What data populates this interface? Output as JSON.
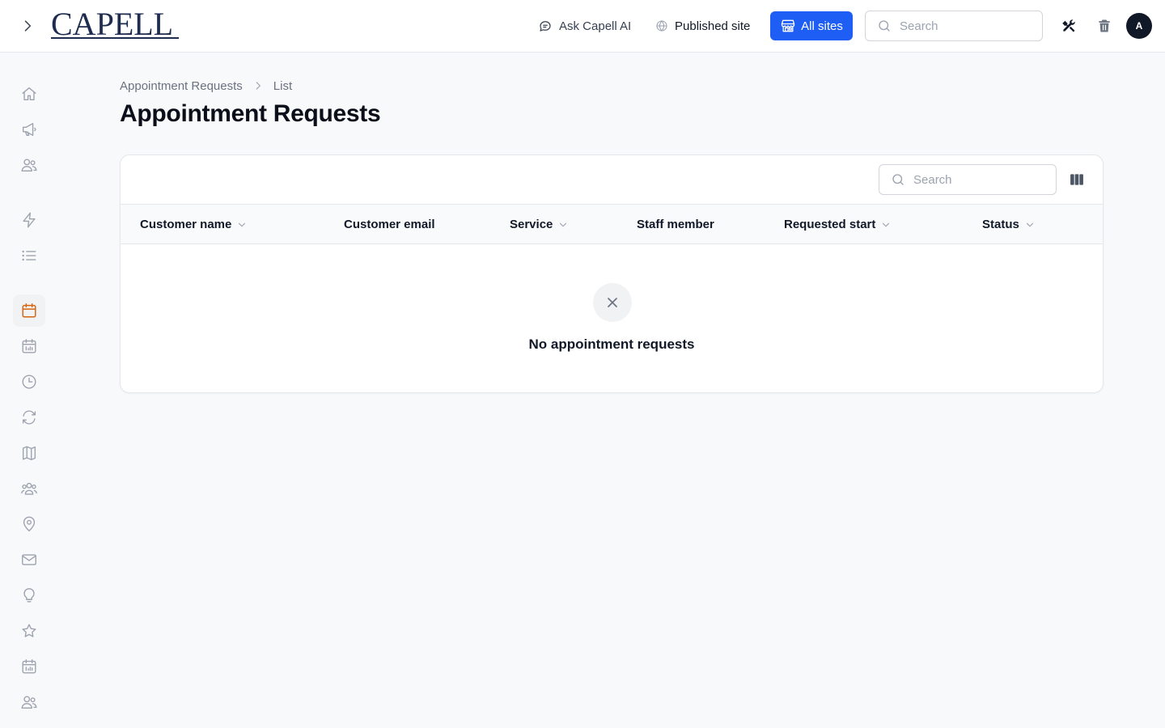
{
  "brand": {
    "logo_text": "CAPELL"
  },
  "header": {
    "ask_ai_label": "Ask Capell AI",
    "published_site_label": "Published site",
    "all_sites_label": "All sites",
    "search_placeholder": "Search",
    "avatar_initial": "A"
  },
  "colors": {
    "accent": "#1f5ef5",
    "active_icon": "#d9640f",
    "brand_navy": "#1d2c4f"
  },
  "sidebar": {
    "items": [
      {
        "icon": "home-icon"
      },
      {
        "icon": "megaphone-icon"
      },
      {
        "icon": "users-icon"
      },
      {
        "icon": "lightning-icon"
      },
      {
        "icon": "list-icon"
      },
      {
        "icon": "calendar-icon",
        "active": true
      },
      {
        "icon": "calendar-days-icon"
      },
      {
        "icon": "clock-icon"
      },
      {
        "icon": "refresh-icon"
      },
      {
        "icon": "map-icon"
      },
      {
        "icon": "user-group-icon"
      },
      {
        "icon": "map-pin-icon"
      },
      {
        "icon": "envelope-icon"
      },
      {
        "icon": "light-bulb-icon"
      },
      {
        "icon": "star-icon"
      },
      {
        "icon": "calendar-days-icon"
      },
      {
        "icon": "users-icon"
      }
    ]
  },
  "breadcrumb": {
    "items": [
      "Appointment Requests",
      "List"
    ]
  },
  "page": {
    "title": "Appointment Requests"
  },
  "table": {
    "search_placeholder": "Search",
    "columns": [
      {
        "label": "Customer name",
        "sortable": true
      },
      {
        "label": "Customer email",
        "sortable": false
      },
      {
        "label": "Service",
        "sortable": true
      },
      {
        "label": "Staff member",
        "sortable": false
      },
      {
        "label": "Requested start",
        "sortable": true
      },
      {
        "label": "Status",
        "sortable": true
      }
    ],
    "rows": [],
    "empty_message": "No appointment requests"
  }
}
